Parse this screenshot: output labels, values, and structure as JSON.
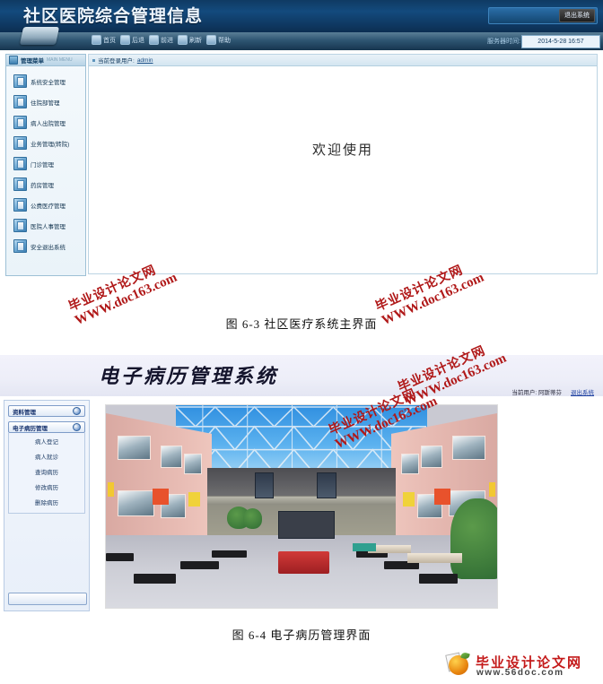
{
  "figure1": {
    "header": {
      "title": "社区医院综合管理信息",
      "logout_button": "退出系统"
    },
    "nav": {
      "items": [
        {
          "label": "首页",
          "icon": "home-icon"
        },
        {
          "label": "后退",
          "icon": "back-arrow-icon"
        },
        {
          "label": "前进",
          "icon": "forward-arrow-icon"
        },
        {
          "label": "刷新",
          "icon": "refresh-icon"
        },
        {
          "label": "帮助",
          "icon": "help-icon"
        }
      ],
      "server_time_label": "服务器时间:",
      "server_time_value": "2014-5-28 16:57"
    },
    "sidebar": {
      "title": "管理菜单",
      "subtitle": "MAIN MENU",
      "items": [
        {
          "label": "系统安全管理",
          "icon": "module-icon"
        },
        {
          "label": "住院部管理",
          "icon": "module-icon"
        },
        {
          "label": "病人出院管理",
          "icon": "module-icon"
        },
        {
          "label": "业务管理(转院)",
          "icon": "module-icon"
        },
        {
          "label": "门诊管理",
          "icon": "module-icon"
        },
        {
          "label": "药房管理",
          "icon": "module-icon"
        },
        {
          "label": "公费医疗管理",
          "icon": "module-icon"
        },
        {
          "label": "医院人事管理",
          "icon": "module-icon"
        },
        {
          "label": "安全退出系统",
          "icon": "module-icon"
        }
      ]
    },
    "main": {
      "current_user_label": "当前登录用户:",
      "current_user_value": "admin",
      "welcome_text": "欢迎使用"
    }
  },
  "caption1": "图 6-3  社区医疗系统主界面",
  "figure2": {
    "header": {
      "title": "电子病历管理系统",
      "current_user_label": "当前用户: 阿斯蒂芬",
      "logout_link": "退出系统"
    },
    "sidebar": {
      "groups": [
        {
          "label": "资料管理",
          "icon": "collapse-toggle-icon",
          "items": []
        },
        {
          "label": "电子病历管理",
          "icon": "collapse-toggle-icon",
          "items": [
            "病人登记",
            "病人就诊",
            "查询病历",
            "修改病历",
            "删除病历"
          ]
        }
      ]
    },
    "content": {
      "image_alt": "医院大厅效果图"
    }
  },
  "caption2": "图 6-4   电子病历管理界面",
  "watermarks": [
    {
      "line1": "毕业设计论文网",
      "line2": "WWW.doc163.com"
    },
    {
      "line1": "毕业设计论文网",
      "line2": "WWW.doc163.com"
    },
    {
      "line1": "毕业设计论文网",
      "line2": "WWW.doc163.com"
    },
    {
      "line1": "毕业设计论文网",
      "line2": "WWW.doc163.com"
    }
  ],
  "footer": {
    "brand": "毕业设计论文网",
    "url": "www.56doc.com"
  },
  "colors": {
    "header_blue": "#134a7d",
    "accent_red": "#b01818",
    "link_blue": "#1b3fa0",
    "wall_pink": "#e8bcb4"
  }
}
